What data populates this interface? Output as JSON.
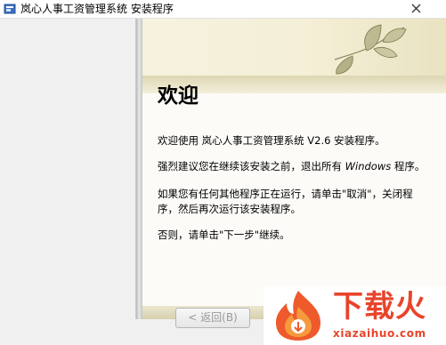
{
  "window": {
    "title": "岚心人事工资管理系统 安装程序",
    "close_icon": "close-icon"
  },
  "wizard": {
    "heading": "欢迎",
    "line1": "欢迎使用 岚心人事工资管理系统 V2.6 安装程序。",
    "line2_prefix": "强烈建议您在继续该安装之前，退出所有 ",
    "line2_em": "Windows",
    "line2_suffix": " 程序。",
    "line3a": "如果您有任何其他程序正在运行，请单击\"取消\"，关闭程",
    "line3b": "序，然后再次运行该安装程序。",
    "line4": "否则，请单击\"下一步\"继续。"
  },
  "buttons": {
    "back": "< 返回(B)"
  },
  "watermark": {
    "brand": "下载火",
    "domain": "xiazaihuo.com"
  },
  "colors": {
    "banner": "#f4efd6",
    "watermark_red": "#e8442b"
  }
}
